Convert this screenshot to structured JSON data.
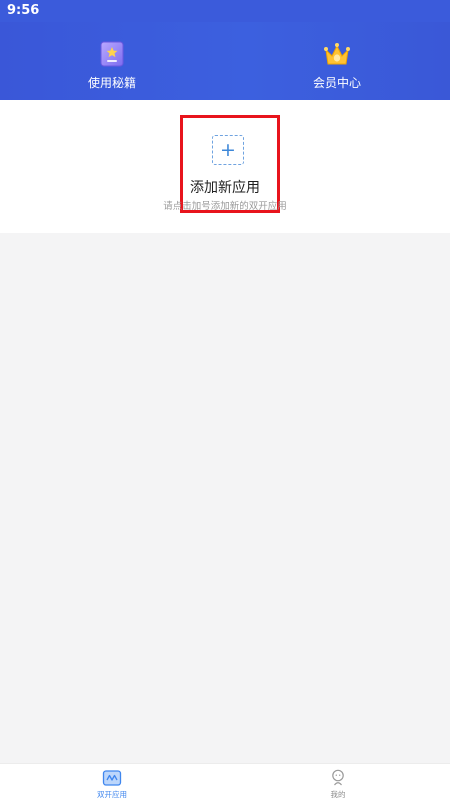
{
  "status_bar": {
    "time": "9:56"
  },
  "header": {
    "tips": {
      "label": "使用秘籍",
      "icon": "book-star-icon"
    },
    "vip": {
      "label": "会员中心",
      "icon": "crown-icon"
    }
  },
  "add_app": {
    "icon": "plus-icon",
    "plus_glyph": "+",
    "title": "添加新应用",
    "hint": "请点击加号添加新的双开应用"
  },
  "bottom_nav": {
    "items": [
      {
        "label": "双开应用",
        "icon": "dual-apps-icon",
        "active": true
      },
      {
        "label": "我的",
        "icon": "profile-icon",
        "active": false
      }
    ]
  },
  "colors": {
    "header_blue": "#3b5bdb",
    "highlight_red": "#e8141c",
    "accent_blue": "#3f86ee",
    "background_gray": "#f4f4f5"
  }
}
